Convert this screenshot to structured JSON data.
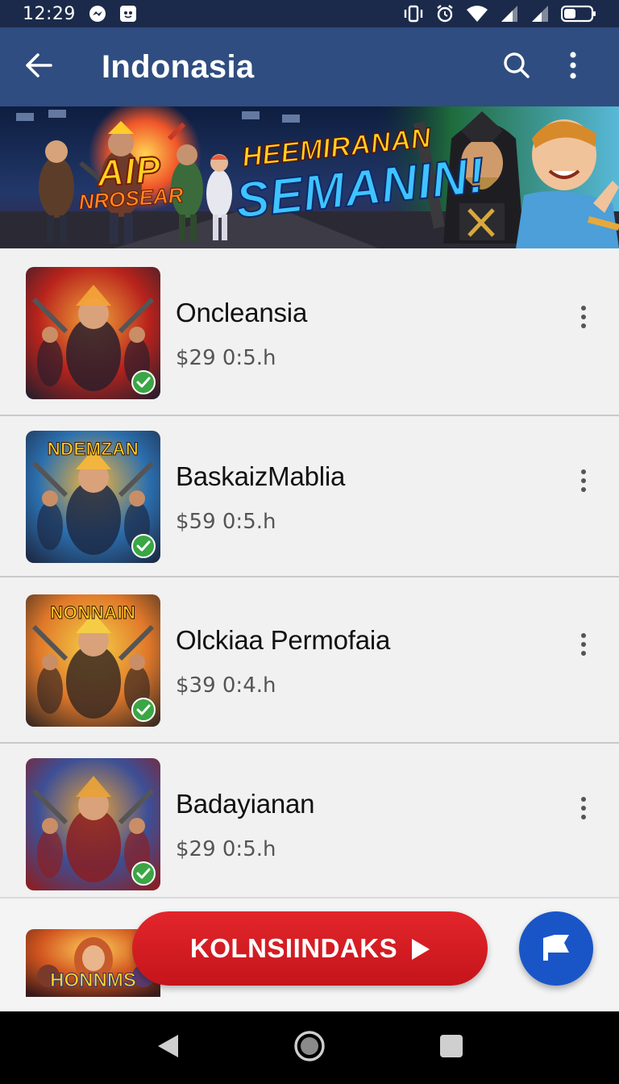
{
  "status_bar": {
    "time": "12:29"
  },
  "app_bar": {
    "title": "Indonasia",
    "back_icon": "arrow-back-icon",
    "search_icon": "search-icon",
    "more_icon": "more-vert-icon"
  },
  "banner": {
    "small_big": "AIP",
    "small_sub": "NROSEAR",
    "headline_top": "HEEMIRANAN",
    "headline_main": "SEMANIN!"
  },
  "games": [
    {
      "title": "Oncleansia",
      "subtitle": "$29 0:5.h",
      "thumb_caption": "",
      "installed": true,
      "palette": [
        "#b8231c",
        "#f2a33a",
        "#2b1e2c"
      ]
    },
    {
      "title": "BaskaizMablia",
      "subtitle": "$59 0:5.h",
      "thumb_caption": "NDEMZAN",
      "installed": true,
      "palette": [
        "#2b6fae",
        "#f6b63b",
        "#1d2a46"
      ]
    },
    {
      "title": "Olckiaa Permofaia",
      "subtitle": "$39 0:4.h",
      "thumb_caption": "NONNAIN",
      "installed": true,
      "palette": [
        "#e0782a",
        "#f5cf46",
        "#3a2a22"
      ]
    },
    {
      "title": "Badayianan",
      "subtitle": "$29 0:5.h",
      "thumb_caption": "",
      "installed": true,
      "palette": [
        "#3d4f96",
        "#e8a23a",
        "#8a1f22"
      ]
    }
  ],
  "peek_item": {
    "thumb_caption": "HONNMS"
  },
  "cta": {
    "label": "KOLNSIINDAKS",
    "icon": "play-icon"
  },
  "fab": {
    "icon": "flag-icon"
  },
  "nav_bar": {
    "back_icon": "nav-back-icon",
    "home_icon": "nav-home-icon",
    "recents_icon": "nav-recents-icon"
  }
}
